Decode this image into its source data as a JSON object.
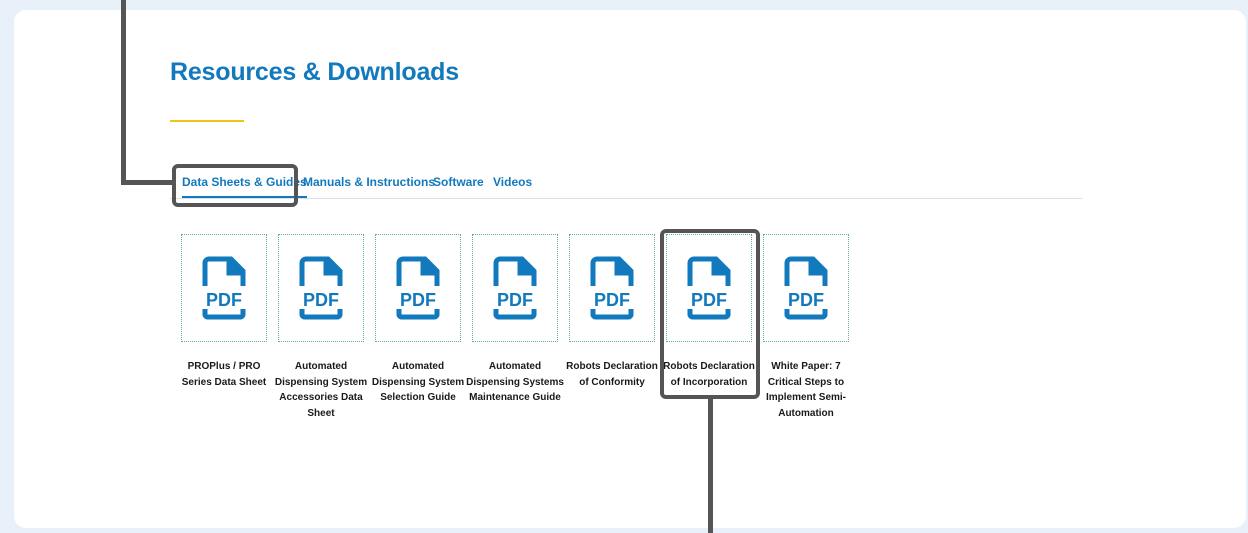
{
  "page": {
    "title": "Resources & Downloads"
  },
  "tabs": [
    {
      "label": "Data Sheets & Guides",
      "active": true
    },
    {
      "label": "Manuals & Instructions",
      "active": false
    },
    {
      "label": "Software",
      "active": false
    },
    {
      "label": "Videos",
      "active": false
    }
  ],
  "documents": [
    {
      "icon": "pdf-icon",
      "icon_text": "PDF",
      "label": "PROPlus / PRO Series Data Sheet"
    },
    {
      "icon": "pdf-icon",
      "icon_text": "PDF",
      "label": "Automated Dispensing System Accessories Data Sheet"
    },
    {
      "icon": "pdf-icon",
      "icon_text": "PDF",
      "label": "Automated Dispensing System Selection Guide"
    },
    {
      "icon": "pdf-icon",
      "icon_text": "PDF",
      "label": "Automated Dispensing Systems Maintenance Guide"
    },
    {
      "icon": "pdf-icon",
      "icon_text": "PDF",
      "label": "Robots Declaration of Conformity"
    },
    {
      "icon": "pdf-icon",
      "icon_text": "PDF",
      "label": "Robots Declaration of Incorporation"
    },
    {
      "icon": "pdf-icon",
      "icon_text": "PDF",
      "label": "White Paper: 7 Critical Steps to Implement Semi-Automation"
    }
  ],
  "colors": {
    "accent": "#1279bd",
    "underline": "#f0c419",
    "highlight": "#555555"
  }
}
